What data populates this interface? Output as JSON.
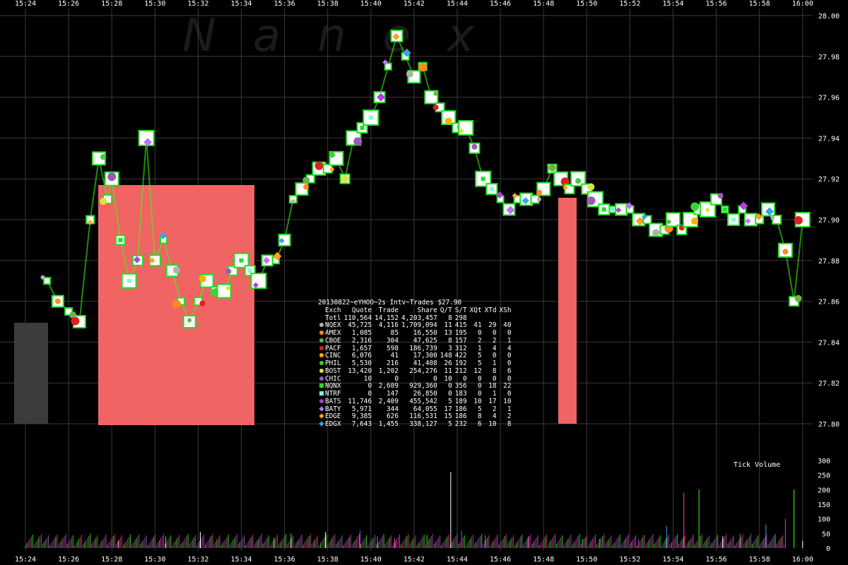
{
  "watermark": "Nanex",
  "chart_data": [
    {
      "type": "scatter",
      "title": "20130822~eYHOO~2s Intv~Trades $27.90",
      "x_ticks": [
        "15:24",
        "15:26",
        "15:28",
        "15:30",
        "15:32",
        "15:34",
        "15:36",
        "15:38",
        "15:40",
        "15:42",
        "15:44",
        "15:46",
        "15:48",
        "15:50",
        "15:52",
        "15:54",
        "15:56",
        "15:58",
        "16:00"
      ],
      "y_ticks": [
        "27.80",
        "27.82",
        "27.84",
        "27.86",
        "27.88",
        "27.90",
        "27.92",
        "27.94",
        "27.96",
        "27.98",
        "28.00"
      ],
      "ylim": [
        27.79,
        28.0
      ],
      "grid": true,
      "price_path": {
        "x": [
          "15:25.0",
          "15:25.5",
          "15:26.0",
          "15:26.5",
          "15:27.0",
          "15:27.4",
          "15:27.8",
          "15:28.0",
          "15:28.4",
          "15:28.8",
          "15:29.2",
          "15:29.6",
          "15:30.0",
          "15:30.4",
          "15:30.8",
          "15:31.2",
          "15:31.6",
          "15:32.0",
          "15:32.4",
          "15:32.8",
          "15:33.2",
          "15:33.6",
          "15:34.0",
          "15:34.4",
          "15:34.8",
          "15:35.2",
          "15:35.6",
          "15:36.0",
          "15:36.4",
          "15:36.8",
          "15:37.2",
          "15:37.6",
          "15:38.0",
          "15:38.4",
          "15:38.8",
          "15:39.2",
          "15:39.6",
          "15:40.0",
          "15:40.4",
          "15:40.8",
          "15:41.2",
          "15:41.6",
          "15:42.0",
          "15:42.4",
          "15:42.8",
          "15:43.2",
          "15:43.6",
          "15:44.0",
          "15:44.4",
          "15:44.8",
          "15:45.2",
          "15:45.6",
          "15:46.0",
          "15:46.4",
          "15:46.8",
          "15:47.2",
          "15:47.6",
          "15:48.0",
          "15:48.4",
          "15:48.8",
          "15:49.2",
          "15:49.6",
          "15:50.0",
          "15:50.4",
          "15:50.8",
          "15:51.2",
          "15:51.6",
          "15:52.0",
          "15:52.4",
          "15:52.8",
          "15:53.2",
          "15:53.6",
          "15:54.0",
          "15:54.4",
          "15:54.8",
          "15:55.2",
          "15:55.6",
          "15:56.0",
          "15:56.4",
          "15:56.8",
          "15:57.2",
          "15:57.6",
          "15:58.0",
          "15:58.4",
          "15:58.8",
          "15:59.2",
          "15:59.6",
          "16:00.0"
        ],
        "y": [
          27.87,
          27.86,
          27.855,
          27.85,
          27.9,
          27.93,
          27.91,
          27.92,
          27.89,
          27.87,
          27.88,
          27.94,
          27.88,
          27.89,
          27.875,
          27.86,
          27.85,
          27.86,
          27.87,
          27.865,
          27.865,
          27.875,
          27.88,
          27.875,
          27.87,
          27.88,
          27.88,
          27.89,
          27.91,
          27.915,
          27.92,
          27.925,
          27.925,
          27.93,
          27.92,
          27.94,
          27.945,
          27.95,
          27.96,
          27.975,
          27.99,
          27.98,
          27.97,
          27.975,
          27.96,
          27.955,
          27.95,
          27.945,
          27.945,
          27.935,
          27.92,
          27.915,
          27.91,
          27.905,
          27.91,
          27.91,
          27.91,
          27.915,
          27.925,
          27.92,
          27.915,
          27.92,
          27.915,
          27.91,
          27.905,
          27.905,
          27.905,
          27.905,
          27.9,
          27.9,
          27.895,
          27.895,
          27.9,
          27.895,
          27.9,
          27.905,
          27.905,
          27.91,
          27.905,
          27.9,
          27.905,
          27.9,
          27.9,
          27.905,
          27.9,
          27.885,
          27.86,
          27.9
        ]
      }
    },
    {
      "type": "bar",
      "title": "Tick Volume",
      "y_ticks": [
        "0",
        "50",
        "100",
        "150",
        "200",
        "250",
        "300"
      ],
      "ylim": [
        0,
        300
      ],
      "spikes": [
        {
          "x": "15:28.3",
          "value": 25
        },
        {
          "x": "15:30.5",
          "value": 40
        },
        {
          "x": "15:32.1",
          "value": 55
        },
        {
          "x": "15:33.0",
          "value": 30
        },
        {
          "x": "15:34.8",
          "value": 30
        },
        {
          "x": "15:35.5",
          "value": 35
        },
        {
          "x": "15:36.3",
          "value": 50
        },
        {
          "x": "15:37.9",
          "value": 55
        },
        {
          "x": "15:39.5",
          "value": 60
        },
        {
          "x": "15:40.3",
          "value": 40
        },
        {
          "x": "15:41.1",
          "value": 35
        },
        {
          "x": "15:42.6",
          "value": 45
        },
        {
          "x": "15:43.7",
          "value": 260
        },
        {
          "x": "15:44.2",
          "value": 60
        },
        {
          "x": "15:45.3",
          "value": 45
        },
        {
          "x": "15:47.3",
          "value": 40
        },
        {
          "x": "15:49.8",
          "value": 30
        },
        {
          "x": "15:50.6",
          "value": 30
        },
        {
          "x": "15:52.4",
          "value": 30
        },
        {
          "x": "15:53.7",
          "value": 75
        },
        {
          "x": "15:54.5",
          "value": 190
        },
        {
          "x": "15:55.2",
          "value": 200
        },
        {
          "x": "15:56.3",
          "value": 40
        },
        {
          "x": "15:57.1",
          "value": 50
        },
        {
          "x": "15:58.3",
          "value": 80
        },
        {
          "x": "15:59.2",
          "value": 100
        },
        {
          "x": "15:59.6",
          "value": 200
        },
        {
          "x": "16:00.0",
          "value": 25
        }
      ]
    }
  ],
  "stats": {
    "headers": [
      "Exch",
      "Quote",
      "Trade",
      "Share",
      "Q/T",
      "S/T",
      "XQt",
      "XTd",
      "XSh"
    ],
    "rows": [
      {
        "exch": "Totl",
        "quote": "110,564",
        "trade": "14,152",
        "share": "4,203,457",
        "qt": "8",
        "st": "298",
        "xqt": "",
        "xtd": "",
        "xsh": "",
        "color": "",
        "shape": "none"
      },
      {
        "exch": "NQEX",
        "quote": "45,725",
        "trade": "4,116",
        "share": "1,709,094",
        "qt": "11",
        "st": "415",
        "xqt": "41",
        "xtd": "29",
        "xsh": "40",
        "color": "#b0b0b0",
        "shape": "circle"
      },
      {
        "exch": "AMEX",
        "quote": "1,085",
        "trade": "85",
        "share": "16,550",
        "qt": "13",
        "st": "195",
        "xqt": "0",
        "xtd": "0",
        "xsh": "0",
        "color": "#ff8c1a",
        "shape": "circle"
      },
      {
        "exch": "CBOE",
        "quote": "2,316",
        "trade": "304",
        "share": "47,625",
        "qt": "8",
        "st": "157",
        "xqt": "2",
        "xtd": "2",
        "xsh": "1",
        "color": "#6cb33f",
        "shape": "circle"
      },
      {
        "exch": "PACF",
        "quote": "1,657",
        "trade": "598",
        "share": "186,739",
        "qt": "3",
        "st": "312",
        "xqt": "1",
        "xtd": "4",
        "xsh": "4",
        "color": "#e02020",
        "shape": "circle"
      },
      {
        "exch": "CINC",
        "quote": "6,076",
        "trade": "41",
        "share": "17,300",
        "qt": "148",
        "st": "422",
        "xqt": "5",
        "xtd": "0",
        "xsh": "0",
        "color": "#ffb000",
        "shape": "circle"
      },
      {
        "exch": "PHIL",
        "quote": "5,530",
        "trade": "216",
        "share": "41,408",
        "qt": "26",
        "st": "192",
        "xqt": "5",
        "xtd": "1",
        "xsh": "0",
        "color": "#3cd23c",
        "shape": "circle"
      },
      {
        "exch": "BOST",
        "quote": "13,420",
        "trade": "1,202",
        "share": "254,276",
        "qt": "11",
        "st": "212",
        "xqt": "12",
        "xtd": "8",
        "xsh": "6",
        "color": "#d8e83a",
        "shape": "circle"
      },
      {
        "exch": "CHIC",
        "quote": "10",
        "trade": "0",
        "share": "0",
        "qt": "10",
        "st": "0",
        "xqt": "0",
        "xtd": "0",
        "xsh": "0",
        "color": "#9b59b6",
        "shape": "circle"
      },
      {
        "exch": "NQNX",
        "quote": "0",
        "trade": "2,609",
        "share": "929,360",
        "qt": "0",
        "st": "356",
        "xqt": "0",
        "xtd": "18",
        "xsh": "22",
        "color": "#20e020",
        "shape": "square"
      },
      {
        "exch": "NTRF",
        "quote": "0",
        "trade": "147",
        "share": "26,850",
        "qt": "0",
        "st": "183",
        "xqt": "0",
        "xtd": "1",
        "xsh": "0",
        "color": "#7fffd4",
        "shape": "square"
      },
      {
        "exch": "BATS",
        "quote": "11,746",
        "trade": "2,409",
        "share": "455,542",
        "qt": "5",
        "st": "189",
        "xqt": "10",
        "xtd": "17",
        "xsh": "10",
        "color": "#b040e0",
        "shape": "diamond"
      },
      {
        "exch": "BATY",
        "quote": "5,971",
        "trade": "344",
        "share": "64,055",
        "qt": "17",
        "st": "186",
        "xqt": "5",
        "xtd": "2",
        "xsh": "1",
        "color": "#c070ff",
        "shape": "diamond"
      },
      {
        "exch": "EDGE",
        "quote": "9,385",
        "trade": "626",
        "share": "116,531",
        "qt": "15",
        "st": "186",
        "xqt": "8",
        "xtd": "4",
        "xsh": "2",
        "color": "#ffa020",
        "shape": "diamond"
      },
      {
        "exch": "EDGX",
        "quote": "7,643",
        "trade": "1,455",
        "share": "338,127",
        "qt": "5",
        "st": "232",
        "xqt": "6",
        "xtd": "10",
        "xsh": "8",
        "color": "#3aa0e8",
        "shape": "diamond"
      }
    ]
  }
}
